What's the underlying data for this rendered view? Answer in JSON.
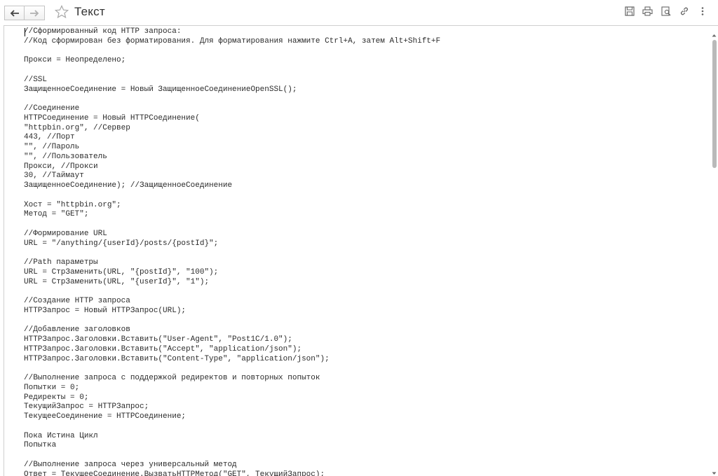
{
  "window": {
    "title": "Текст"
  },
  "toolbar": {
    "back_icon": "arrow-left-icon",
    "forward_icon": "arrow-right-icon",
    "favorite_icon": "star-icon",
    "tools": [
      "save-icon",
      "print-icon",
      "preview-icon",
      "link-icon",
      "more-icon"
    ]
  },
  "editor": {
    "lines": [
      "//Сформированный код HTTP запроса:",
      "//Код сформирован без форматирования. Для форматирования нажмите Ctrl+A, затем Alt+Shift+F",
      "",
      "Прокси = Неопределено;",
      "",
      "//SSL",
      "ЗащищенноеСоединение = Новый ЗащищенноеСоединениеOpenSSL();",
      "",
      "//Соединение",
      "HTTPСоединение = Новый HTTPСоединение(",
      "\"httpbin.org\", //Сервер",
      "443, //Порт",
      "\"\", //Пароль",
      "\"\", //Пользователь",
      "Прокси, //Прокси",
      "30, //Таймаут",
      "ЗащищенноеСоединение); //ЗащищенноеСоединение",
      "",
      "Хост = \"httpbin.org\";",
      "Метод = \"GET\";",
      "",
      "//Формирование URL",
      "URL = \"/anything/{userId}/posts/{postId}\";",
      "",
      "//Path параметры",
      "URL = СтрЗаменить(URL, \"{postId}\", \"100\");",
      "URL = СтрЗаменить(URL, \"{userId}\", \"1\");",
      "",
      "//Создание HTTP запроса",
      "HTTPЗапрос = Новый HTTPЗапрос(URL);",
      "",
      "//Добавление заголовков",
      "HTTPЗапрос.Заголовки.Вставить(\"User-Agent\", \"Post1C/1.0\");",
      "HTTPЗапрос.Заголовки.Вставить(\"Accept\", \"application/json\");",
      "HTTPЗапрос.Заголовки.Вставить(\"Content-Type\", \"application/json\");",
      "",
      "//Выполнение запроса с поддержкой редиректов и повторных попыток",
      "Попытки = 0;",
      "Редиректы = 0;",
      "ТекущийЗапрос = HTTPЗапрос;",
      "ТекущееСоединение = HTTPСоединение;",
      "",
      "Пока Истина Цикл",
      "Попытка",
      "",
      "//Выполнение запроса через универсальный метод",
      "Ответ = ТекущееСоединение.ВызватьHTTPМетод(\"GET\", ТекущийЗапрос);"
    ]
  },
  "scrollbar": {
    "position_fraction": 0.0,
    "visible_fraction": 0.3
  }
}
